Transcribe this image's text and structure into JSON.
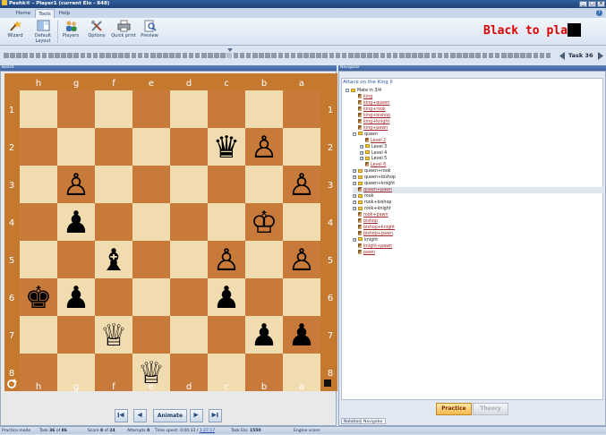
{
  "window": {
    "title": "Peshk® - Player1 (current Elo - 848)",
    "buttons": [
      "_",
      "□",
      "×"
    ]
  },
  "ribbon_tabs": [
    "Home",
    "Tools",
    "Help"
  ],
  "active_tab": "Tools",
  "ribbon_buttons": [
    {
      "label": "Wizard",
      "icon": "wizard-icon"
    },
    {
      "label": "Default Layout",
      "icon": "layout-icon"
    },
    {
      "label": "Players",
      "icon": "players-icon"
    },
    {
      "label": "Options",
      "icon": "options-icon"
    },
    {
      "label": "Quick print",
      "icon": "print-icon"
    },
    {
      "label": "Preview",
      "icon": "preview-icon"
    }
  ],
  "turn": {
    "text": "Black to play",
    "side_color": "#000000"
  },
  "task": {
    "label": "Task 36",
    "current": 36,
    "total": 86
  },
  "panels": {
    "board": "Board",
    "navigator": "Navigator"
  },
  "board": {
    "files": [
      "h",
      "g",
      "f",
      "e",
      "d",
      "c",
      "b",
      "a"
    ],
    "ranks": [
      "1",
      "2",
      "3",
      "4",
      "5",
      "6",
      "7",
      "8"
    ],
    "light_color": "#f1dcb0",
    "dark_color": "#c87a3b",
    "pieces": [
      {
        "sq": [
          1,
          5
        ],
        "glyph": "♛",
        "name": "black-queen"
      },
      {
        "sq": [
          1,
          6
        ],
        "glyph": "♙",
        "name": "white-pawn"
      },
      {
        "sq": [
          2,
          1
        ],
        "glyph": "♙",
        "name": "white-pawn"
      },
      {
        "sq": [
          2,
          7
        ],
        "glyph": "♙",
        "name": "white-pawn"
      },
      {
        "sq": [
          3,
          1
        ],
        "glyph": "♟",
        "name": "black-pawn"
      },
      {
        "sq": [
          3,
          6
        ],
        "glyph": "♔",
        "name": "white-king"
      },
      {
        "sq": [
          4,
          2
        ],
        "glyph": "♝",
        "name": "black-bishop"
      },
      {
        "sq": [
          4,
          5
        ],
        "glyph": "♙",
        "name": "white-pawn"
      },
      {
        "sq": [
          4,
          7
        ],
        "glyph": "♙",
        "name": "white-pawn"
      },
      {
        "sq": [
          5,
          0
        ],
        "glyph": "♚",
        "name": "black-king"
      },
      {
        "sq": [
          5,
          1
        ],
        "glyph": "♟",
        "name": "black-pawn"
      },
      {
        "sq": [
          5,
          5
        ],
        "glyph": "♟",
        "name": "black-pawn"
      },
      {
        "sq": [
          6,
          2
        ],
        "glyph": "♕",
        "name": "white-queen"
      },
      {
        "sq": [
          6,
          6
        ],
        "glyph": "♟",
        "name": "black-pawn"
      },
      {
        "sq": [
          6,
          7
        ],
        "glyph": "♟",
        "name": "black-pawn"
      },
      {
        "sq": [
          7,
          3
        ],
        "glyph": "♕",
        "name": "white-queen"
      }
    ]
  },
  "animate": {
    "label": "Animate"
  },
  "navigator": {
    "title": "Attack on the King II",
    "nodes": [
      {
        "text": "Mate in 3/4",
        "kind": "folder",
        "level": 0,
        "exp": "−"
      },
      {
        "text": "king",
        "kind": "link",
        "level": 1
      },
      {
        "text": "king+queen",
        "kind": "link",
        "level": 1
      },
      {
        "text": "king+rook",
        "kind": "link",
        "level": 1
      },
      {
        "text": "king+bishop",
        "kind": "link",
        "level": 1
      },
      {
        "text": "king+knight",
        "kind": "link",
        "level": 1
      },
      {
        "text": "king+pawn",
        "kind": "link",
        "level": 1
      },
      {
        "text": "queen",
        "kind": "folder",
        "level": 1,
        "exp": "−"
      },
      {
        "text": "Level 2",
        "kind": "link",
        "level": 2
      },
      {
        "text": "Level 3",
        "kind": "folder",
        "level": 2,
        "exp": "+"
      },
      {
        "text": "Level 4",
        "kind": "folder",
        "level": 2,
        "exp": "+"
      },
      {
        "text": "Level 5",
        "kind": "folder",
        "level": 2,
        "exp": "+"
      },
      {
        "text": "Level 6",
        "kind": "link",
        "level": 2
      },
      {
        "text": "queen+rook",
        "kind": "folder",
        "level": 1,
        "exp": "+"
      },
      {
        "text": "queen+bishop",
        "kind": "folder",
        "level": 1,
        "exp": "+"
      },
      {
        "text": "queen+knight",
        "kind": "folder",
        "level": 1,
        "exp": "+"
      },
      {
        "text": "queen+pawn",
        "kind": "link",
        "level": 1,
        "selected": true
      },
      {
        "text": "rook",
        "kind": "folder",
        "level": 1,
        "exp": "+"
      },
      {
        "text": "rook+bishop",
        "kind": "folder",
        "level": 1,
        "exp": "+"
      },
      {
        "text": "rook+knight",
        "kind": "folder",
        "level": 1,
        "exp": "+"
      },
      {
        "text": "rook+pawn",
        "kind": "link",
        "level": 1
      },
      {
        "text": "bishop",
        "kind": "link",
        "level": 1
      },
      {
        "text": "bishop+knight",
        "kind": "link",
        "level": 1
      },
      {
        "text": "bishop+pawn",
        "kind": "link",
        "level": 1
      },
      {
        "text": "knight",
        "kind": "folder",
        "level": 1,
        "exp": "+"
      },
      {
        "text": "knight+pawn",
        "kind": "link",
        "level": 1
      },
      {
        "text": "pawn",
        "kind": "link",
        "level": 1
      }
    ],
    "buttons": {
      "practice": "Practice",
      "theory": "Theory"
    },
    "tabs": [
      "Notation",
      "Navigator"
    ],
    "active_tab": "Navigator"
  },
  "status": {
    "mode": "Practice mode",
    "task_prefix": "Task ",
    "task_num": "36",
    "task_of": " of ",
    "task_total": "86",
    "score_prefix": "Score ",
    "score_num": "8",
    "score_of": " of ",
    "score_total": "24",
    "attempts_prefix": "Attempts ",
    "attempts": "0",
    "time_prefix": "Time spent: ",
    "time": "0:00:33 / ",
    "time_link": "1:27:17",
    "elo_prefix": "Task Elo: ",
    "elo": "1550",
    "engine": "Engine score:"
  }
}
